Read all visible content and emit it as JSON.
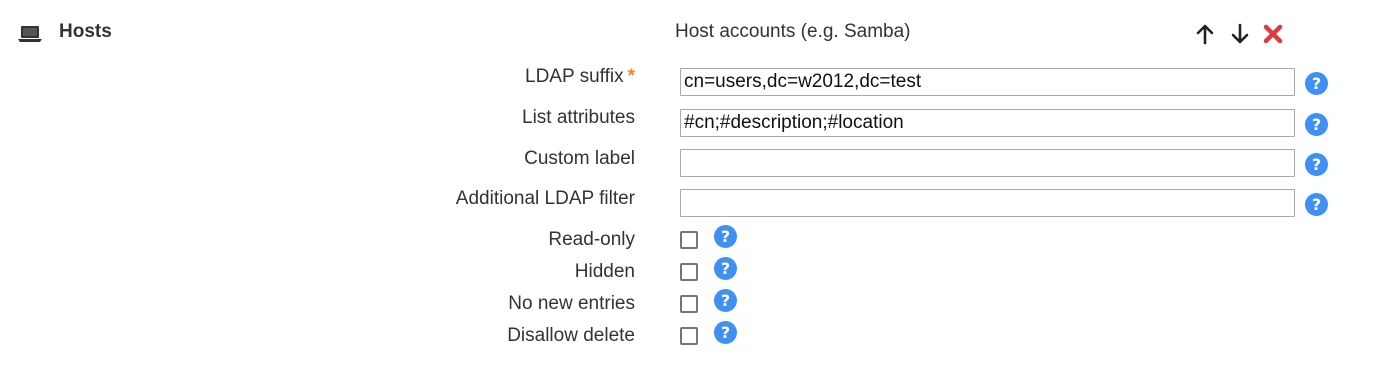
{
  "section": {
    "title": "Hosts",
    "type_label": "Host accounts (e.g. Samba)",
    "icon": "laptop-icon"
  },
  "controls": {
    "move_up_icon": "arrow-up-icon",
    "move_down_icon": "arrow-down-icon",
    "remove_icon": "remove-icon",
    "remove_color": "#e0393e"
  },
  "fields": {
    "ldap_suffix": {
      "label": "LDAP suffix",
      "required_mark": "*",
      "value": "cn=users,dc=w2012,dc=test"
    },
    "list_attributes": {
      "label": "List attributes",
      "value": "#cn;#description;#location"
    },
    "custom_label": {
      "label": "Custom label",
      "value": ""
    },
    "ldap_filter": {
      "label": "Additional LDAP filter",
      "value": ""
    }
  },
  "checkboxes": {
    "read_only": {
      "label": "Read-only",
      "checked": false
    },
    "hidden": {
      "label": "Hidden",
      "checked": false
    },
    "no_new_entries": {
      "label": "No new entries",
      "checked": false
    },
    "disallow_delete": {
      "label": "Disallow delete",
      "checked": false
    }
  },
  "help": {
    "glyph": "?",
    "color": "#3f8ff5"
  },
  "colors": {
    "required": "#f28a1b",
    "text": "#333333"
  }
}
